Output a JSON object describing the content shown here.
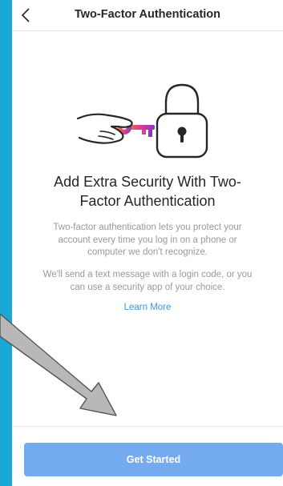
{
  "header": {
    "title": "Two-Factor Authentication",
    "back_icon": "chevron-left-icon"
  },
  "illustration": {
    "icon": "hand-key-padlock-icon",
    "key_colors": [
      "#e4408a",
      "#f58529",
      "#8a3ab9"
    ]
  },
  "content": {
    "headline_line1": "Add Extra Security With Two-",
    "headline_line2": "Factor Authentication",
    "p1_line1": "Two-factor authentication lets you protect your",
    "p1_line2": "account every time you log in on a phone or",
    "p1_line3": "computer we don't recognize.",
    "p2_line1": "We'll send a text message with a login code, or you",
    "p2_line2": "can use a security app of your choice.",
    "learn_more": "Learn More"
  },
  "footer": {
    "cta_label": "Get Started"
  },
  "colors": {
    "background": "#1aa9d6",
    "link": "#3897f0",
    "button": "#74abee",
    "arrow": "#b8b8b8"
  }
}
